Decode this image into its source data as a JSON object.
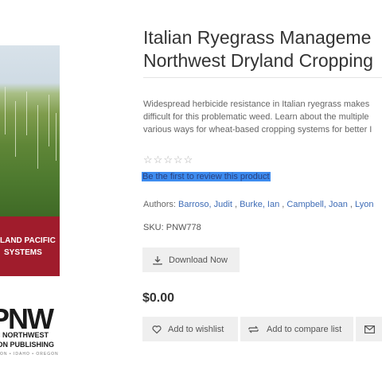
{
  "product": {
    "title_line1": "Italian Ryegrass Manageme",
    "title_line2": "Northwest Dryland Cropping",
    "description_lines": [
      "Widespread herbicide resistance in Italian ryegrass makes",
      "difficult for this problematic weed. Learn about the multiple",
      "various ways for wheat-based cropping systems for better I"
    ],
    "review_link": "Be the first to review this product",
    "authors_label": "Authors: ",
    "authors": [
      "Barroso, Judit",
      "Burke, Ian",
      "Campbell, Joan",
      "Lyon"
    ],
    "sku": "SKU: PNW778",
    "download_label": "Download Now",
    "price": "$0.00",
    "wishlist_label": "Add to wishlist",
    "compare_label": "Add to compare list",
    "rating_stars": 0
  },
  "cover": {
    "text_line1": "LAND PACIFIC",
    "text_line2": "SYSTEMS",
    "band_color": "#a01c2c"
  },
  "publisher": {
    "logo_text": "PNW",
    "line1": "C NORTHWEST",
    "line2": "ION PUBLISHING",
    "states": "ON • IDAHO • OREGON"
  },
  "icons": {
    "download": "download-icon",
    "wishlist": "heart-icon",
    "compare": "compare-icon",
    "email": "envelope-icon"
  }
}
